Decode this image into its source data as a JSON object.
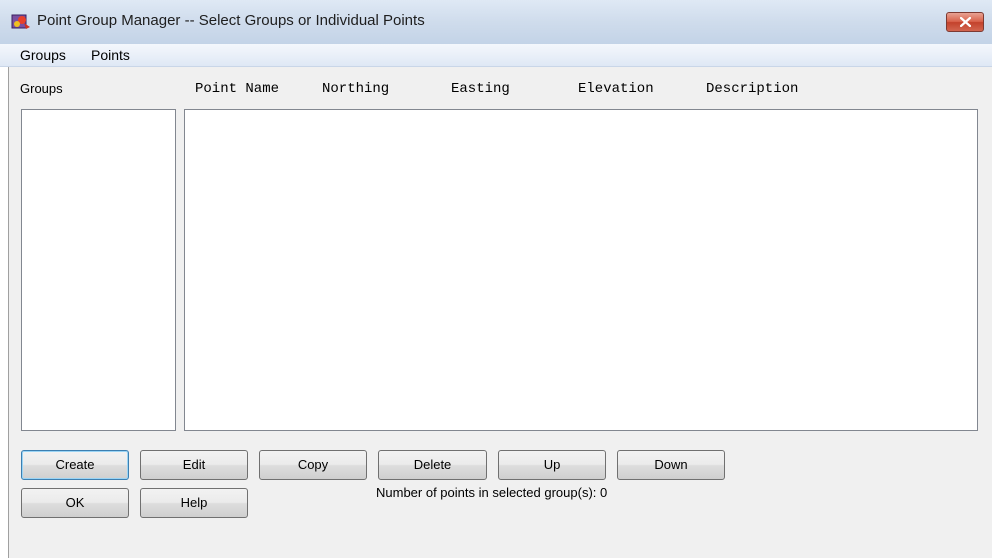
{
  "window": {
    "title": "Point Group Manager -- Select Groups or Individual Points",
    "close_symbol": "x"
  },
  "menu": {
    "items": [
      {
        "label": "Groups"
      },
      {
        "label": "Points"
      }
    ]
  },
  "groups_panel": {
    "label": "Groups"
  },
  "points_table": {
    "columns": [
      "Point Name",
      "Northing",
      "Easting",
      "Elevation",
      "Description"
    ],
    "rows": []
  },
  "buttons": {
    "create": "Create",
    "edit": "Edit",
    "copy": "Copy",
    "delete": "Delete",
    "up": "Up",
    "down": "Down",
    "ok": "OK",
    "help": "Help"
  },
  "status": {
    "point_count_label": "Number of points in selected group(s):",
    "point_count": "0"
  },
  "icons": {
    "app": "point-group-manager-icon",
    "close": "close-icon"
  }
}
